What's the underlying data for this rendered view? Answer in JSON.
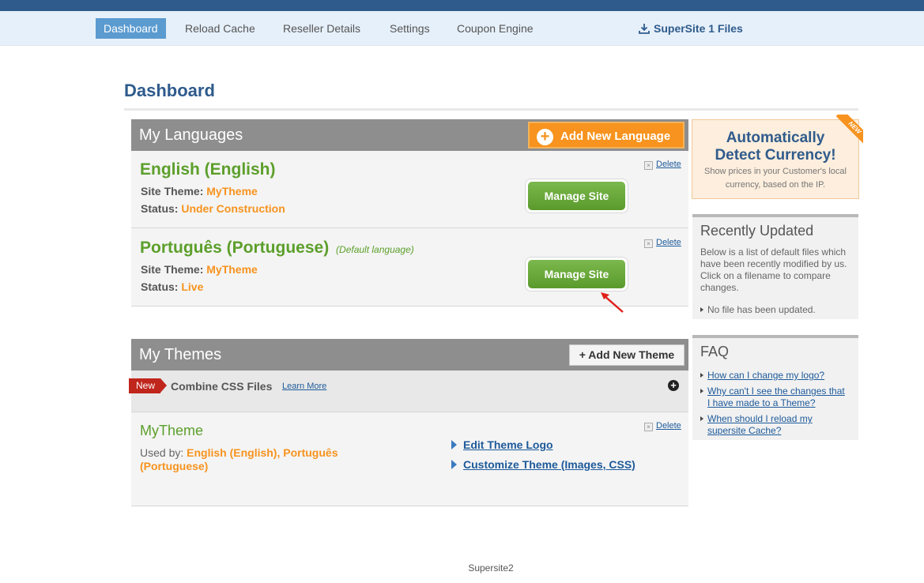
{
  "nav": {
    "items": [
      "Dashboard",
      "Reload Cache",
      "Reseller Details",
      "Settings",
      "Coupon Engine"
    ],
    "active": "Dashboard",
    "files_link": "SuperSite 1 Files"
  },
  "page": {
    "title": "Dashboard"
  },
  "languages": {
    "header": "My Languages",
    "add_button": "Add New Language",
    "site_theme_label": "Site Theme:",
    "status_label": "Status:",
    "manage_label": "Manage Site",
    "delete_label": "Delete",
    "items": [
      {
        "name": "English (English)",
        "default_tag": "",
        "theme": "MyTheme",
        "status": "Under Construction"
      },
      {
        "name": "Português (Portuguese)",
        "default_tag": "(Default language)",
        "theme": "MyTheme",
        "status": "Live"
      }
    ]
  },
  "themes": {
    "header": "My Themes",
    "add_button": "+ Add New Theme",
    "new_badge": "New",
    "combine_title": "Combine CSS Files",
    "learn_more": "Learn More",
    "theme_name": "MyTheme",
    "used_by_label": "Used by:",
    "used_by_value": "English (English), Português (Portuguese)",
    "delete_label": "Delete",
    "links": [
      "Edit Theme Logo",
      "Customize Theme (Images, CSS)"
    ]
  },
  "sidebar": {
    "currency": {
      "ribbon": "NEW",
      "title_line1": "Automatically",
      "title_line2": "Detect Currency!",
      "subtitle": "Show prices in your Customer's local currency, based on the IP."
    },
    "recent": {
      "title": "Recently Updated",
      "text": "Below is a list of default files which have been recently modified by us. Click on a filename to compare changes.",
      "empty": "No file has been updated."
    },
    "faq": {
      "title": "FAQ",
      "items": [
        "How can I change my logo?",
        "Why can't I see the changes that I have made to a Theme?",
        "When should I reload my supersite Cache?"
      ]
    }
  },
  "footer": {
    "text": "Supersite2"
  },
  "colors": {
    "brand": "#2f5b8c",
    "accent_orange": "#f7931e",
    "green": "#5c9f2b",
    "link": "#1d5a9a"
  }
}
